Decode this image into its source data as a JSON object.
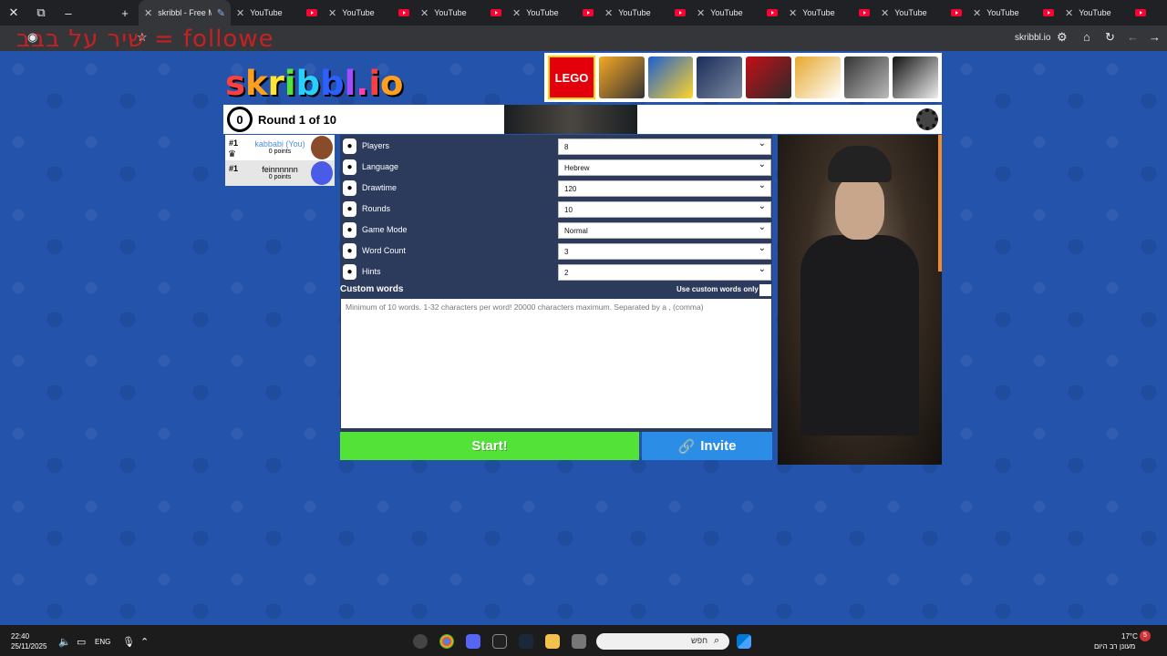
{
  "browser": {
    "active_tab_title": "skribbl - Free M",
    "tabs": [
      "YouTube",
      "YouTube",
      "YouTube",
      "YouTube",
      "YouTube",
      "YouTube",
      "YouTube",
      "YouTube",
      "YouTube",
      "YouTube"
    ],
    "overlay_text": "שיר על בבב = followe",
    "url": "skribbl.io"
  },
  "game": {
    "logo": [
      "s",
      "k",
      "r",
      "i",
      "b",
      "b",
      "l",
      ".",
      "i",
      "o"
    ],
    "logo_colors": [
      "#ff3f3f",
      "#ff9f1f",
      "#ffe52f",
      "#52e437",
      "#27d0ff",
      "#2c5fff",
      "#a24bff",
      "#ff3fb0",
      "#ff3f3f",
      "#ff9f1f"
    ],
    "timer": "0",
    "round_text": "Round 1 of 10",
    "ad_banner_brand": "LEGO",
    "players": [
      {
        "rank": "#1",
        "name": "kabbabi (You)",
        "points": "0 points",
        "name_color": "#4a90e2",
        "avatar_color": "#8a4b2b"
      },
      {
        "rank": "#1",
        "name": "feinnnnnn",
        "points": "0 points",
        "name_color": "#000000",
        "avatar_color": "#4a5be8"
      }
    ],
    "settings": [
      {
        "label": "Players",
        "value": "8",
        "icon": "player-icon"
      },
      {
        "label": "Language",
        "value": "Hebrew",
        "icon": "language-icon"
      },
      {
        "label": "Drawtime",
        "value": "120",
        "icon": "clock-icon"
      },
      {
        "label": "Rounds",
        "value": "10",
        "icon": "round-icon"
      },
      {
        "label": "Game Mode",
        "value": "Normal",
        "icon": "gamemode-icon"
      },
      {
        "label": "Word Count",
        "value": "3",
        "icon": "wordcount-icon"
      },
      {
        "label": "Hints",
        "value": "2",
        "icon": "hints-icon"
      }
    ],
    "custom_words_label": "Custom words",
    "custom_only_label": "Use custom words only",
    "custom_words_placeholder": "Minimum of 10 words. 1-32 characters per word! 20000 characters maximum. Separated by a , (comma)",
    "start_label": "Start!",
    "invite_label": "Invite"
  },
  "taskbar": {
    "time": "22:40",
    "date": "25/11/2025",
    "lang": "ENG",
    "search_placeholder": "חפש",
    "temp": "17°C",
    "weather": "מעונן רב היום",
    "notification_count": "5"
  },
  "colors": {
    "page_bg": "#2353ab",
    "start_btn": "#53e237",
    "invite_btn": "#2c8de7",
    "settings_bg": "#2c3a5c"
  }
}
